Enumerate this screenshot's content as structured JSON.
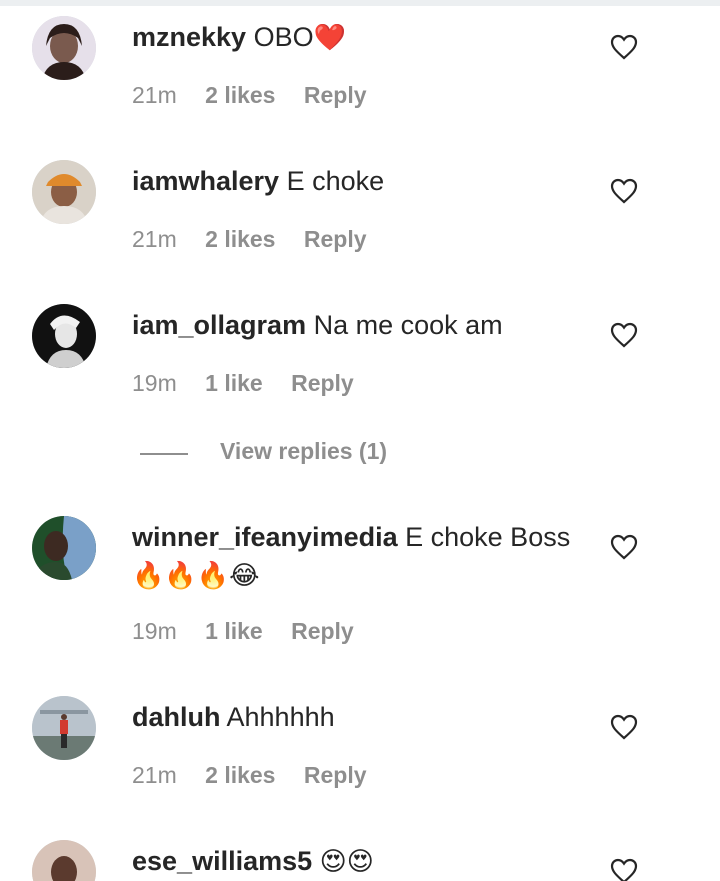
{
  "comments": [
    {
      "username": "mznekky",
      "text": "OBO",
      "emoji": "❤️",
      "time": "21m",
      "likes": "2 likes",
      "reply": "Reply",
      "avatar_colors": [
        "#e6e0ea",
        "#2b1d1a",
        "#7a5a4e"
      ]
    },
    {
      "username": "iamwhalery",
      "text": "E choke",
      "emoji": "",
      "time": "21m",
      "likes": "2 likes",
      "reply": "Reply",
      "avatar_colors": [
        "#d9d2c8",
        "#e08a2c",
        "#8b5e45"
      ]
    },
    {
      "username": "iam_ollagram",
      "text": "Na me cook am",
      "emoji": "",
      "time": "19m",
      "likes": "1 like",
      "reply": "Reply",
      "avatar_colors": [
        "#111111",
        "#333333",
        "#f2f2f2"
      ]
    },
    {
      "username": "winner_ifeanyimedia",
      "text": "E choke Boss",
      "emoji": "🔥🔥🔥😂",
      "time": "19m",
      "likes": "1 like",
      "reply": "Reply",
      "avatar_colors": [
        "#1f4f2a",
        "#3d2a22",
        "#7aa0c8"
      ]
    },
    {
      "username": "dahluh",
      "text": "Ahhhhhh",
      "emoji": "",
      "time": "21m",
      "likes": "2 likes",
      "reply": "Reply",
      "avatar_colors": [
        "#b9c3cc",
        "#d23a2f",
        "#6b7a74"
      ]
    },
    {
      "username": "ese_williams5",
      "text": "",
      "emoji": "😍😍",
      "time": "",
      "likes": "",
      "reply": "",
      "avatar_colors": [
        "#d8c3b8",
        "#5b3a2e",
        "#e8a7a0"
      ]
    }
  ],
  "view_replies": {
    "label": "View replies (1)"
  },
  "colors": {
    "primary_text": "#262626",
    "secondary_text": "#8e8e8e",
    "divider": "#eceff1"
  },
  "icons": {
    "like": "heart-outline-icon"
  }
}
